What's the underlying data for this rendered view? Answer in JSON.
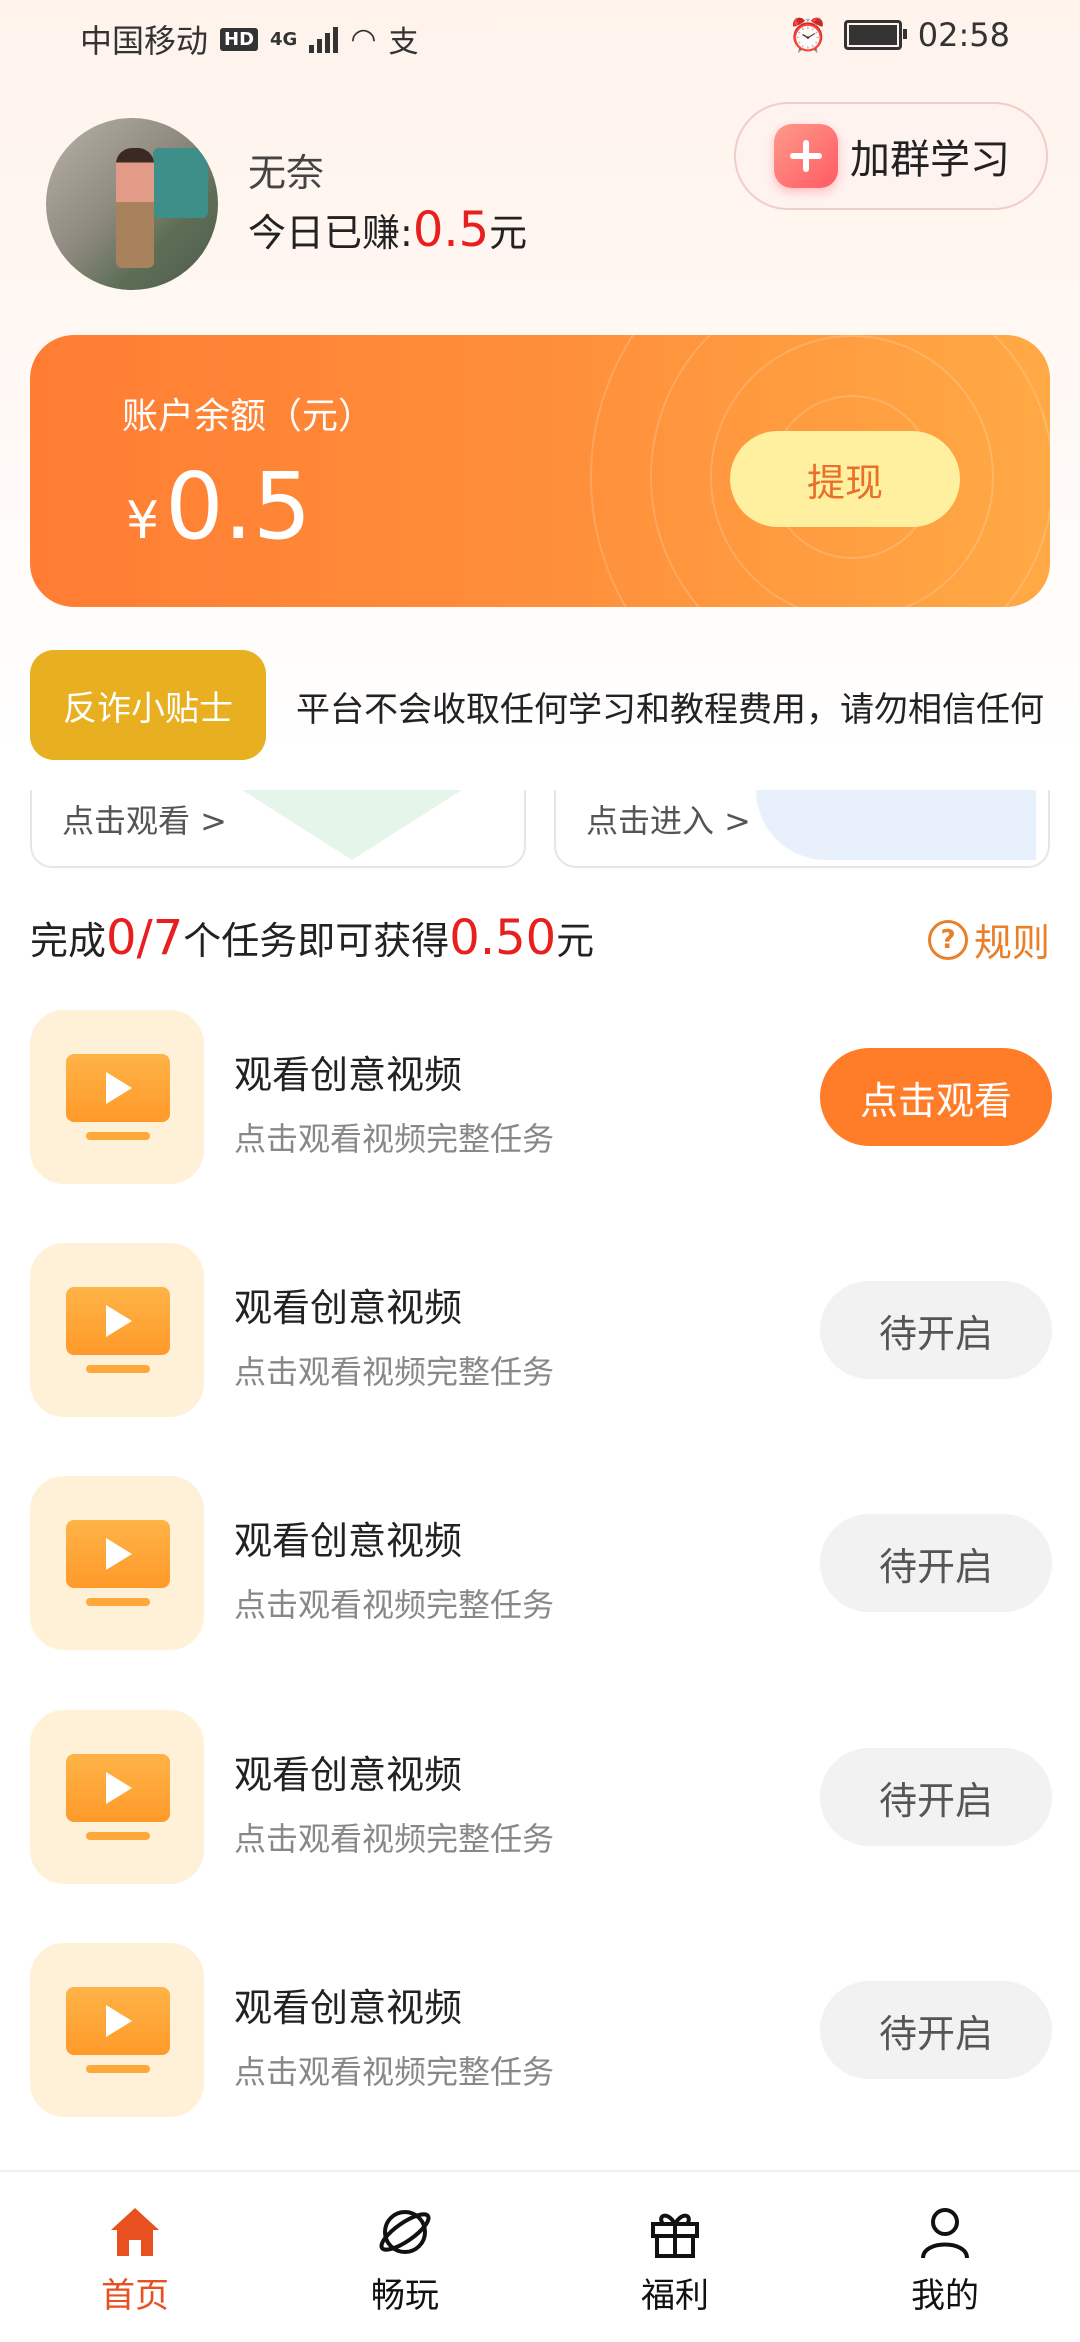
{
  "status_bar": {
    "carrier": "中国移动",
    "network": "4G",
    "time": "02:58"
  },
  "profile": {
    "username": "无奈",
    "earned_prefix": "今日已赚:",
    "earned_amount": "0.5",
    "earned_unit": "元",
    "join_label": "加群学习"
  },
  "balance": {
    "label": "账户余额（元）",
    "currency": "¥",
    "value": "0.5",
    "withdraw_label": "提现"
  },
  "anti_fraud": {
    "badge": "反诈小贴士",
    "text": "平台不会收取任何学习和教程费用，请勿相信任何"
  },
  "entries": [
    {
      "label": "点击观看 >"
    },
    {
      "label": "点击进入 >"
    }
  ],
  "task_header": {
    "prefix": "完成",
    "progress": "0/7",
    "middle": "个任务即可获得",
    "reward": "0.50",
    "unit": "元",
    "rules_label": "规则"
  },
  "tasks": [
    {
      "title": "观看创意视频",
      "subtitle": "点击观看视频完整任务",
      "button": "点击观看",
      "state": "active"
    },
    {
      "title": "观看创意视频",
      "subtitle": "点击观看视频完整任务",
      "button": "待开启",
      "state": "pending"
    },
    {
      "title": "观看创意视频",
      "subtitle": "点击观看视频完整任务",
      "button": "待开启",
      "state": "pending"
    },
    {
      "title": "观看创意视频",
      "subtitle": "点击观看视频完整任务",
      "button": "待开启",
      "state": "pending"
    },
    {
      "title": "观看创意视频",
      "subtitle": "点击观看视频完整任务",
      "button": "待开启",
      "state": "pending"
    }
  ],
  "tabbar": [
    {
      "label": "首页",
      "icon": "home-icon",
      "active": true
    },
    {
      "label": "畅玩",
      "icon": "planet-icon",
      "active": false
    },
    {
      "label": "福利",
      "icon": "gift-icon",
      "active": false
    },
    {
      "label": "我的",
      "icon": "user-icon",
      "active": false
    }
  ],
  "colors": {
    "accent": "#ff7d28",
    "red": "#e81f1f",
    "badge": "#e8b020",
    "tab_active": "#e8501f"
  }
}
